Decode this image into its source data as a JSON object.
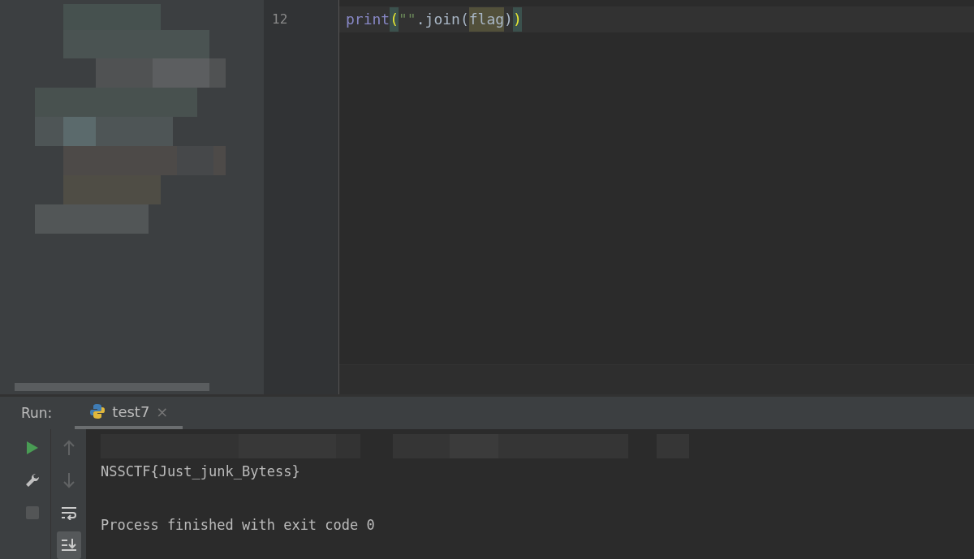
{
  "project_panel": {
    "kind": "picture"
  },
  "editor": {
    "lines": [
      {
        "number": "12",
        "tokens": [
          {
            "text": "print",
            "kind": "builtin"
          },
          {
            "text": "(",
            "kind": "brace-match"
          },
          {
            "text": "\"\"",
            "kind": "string"
          },
          {
            "text": ".join(",
            "kind": "plain"
          },
          {
            "text": "flag",
            "kind": "usage"
          },
          {
            "text": ")",
            "kind": "plain"
          },
          {
            "text": ")",
            "kind": "brace-match"
          }
        ]
      }
    ]
  },
  "run_panel": {
    "label": "Run:",
    "tabs": [
      {
        "title": "test7",
        "close": "×",
        "selected": true
      }
    ],
    "left_tools": [
      {
        "kind": "run",
        "disabled": false
      },
      {
        "kind": "settings",
        "disabled": false
      },
      {
        "kind": "stop",
        "disabled": true
      }
    ],
    "right_tools": [
      {
        "kind": "up",
        "disabled": true
      },
      {
        "kind": "down",
        "disabled": true
      },
      {
        "kind": "wrap",
        "selected": false
      },
      {
        "kind": "scroll-end",
        "selected": true
      }
    ],
    "output": [
      {
        "kind": "picture"
      },
      {
        "kind": "text",
        "text": "NSSCTF{Just_junk_Bytess}"
      },
      {
        "kind": "blank"
      },
      {
        "kind": "text",
        "text": "Process finished with exit code 0"
      }
    ]
  }
}
